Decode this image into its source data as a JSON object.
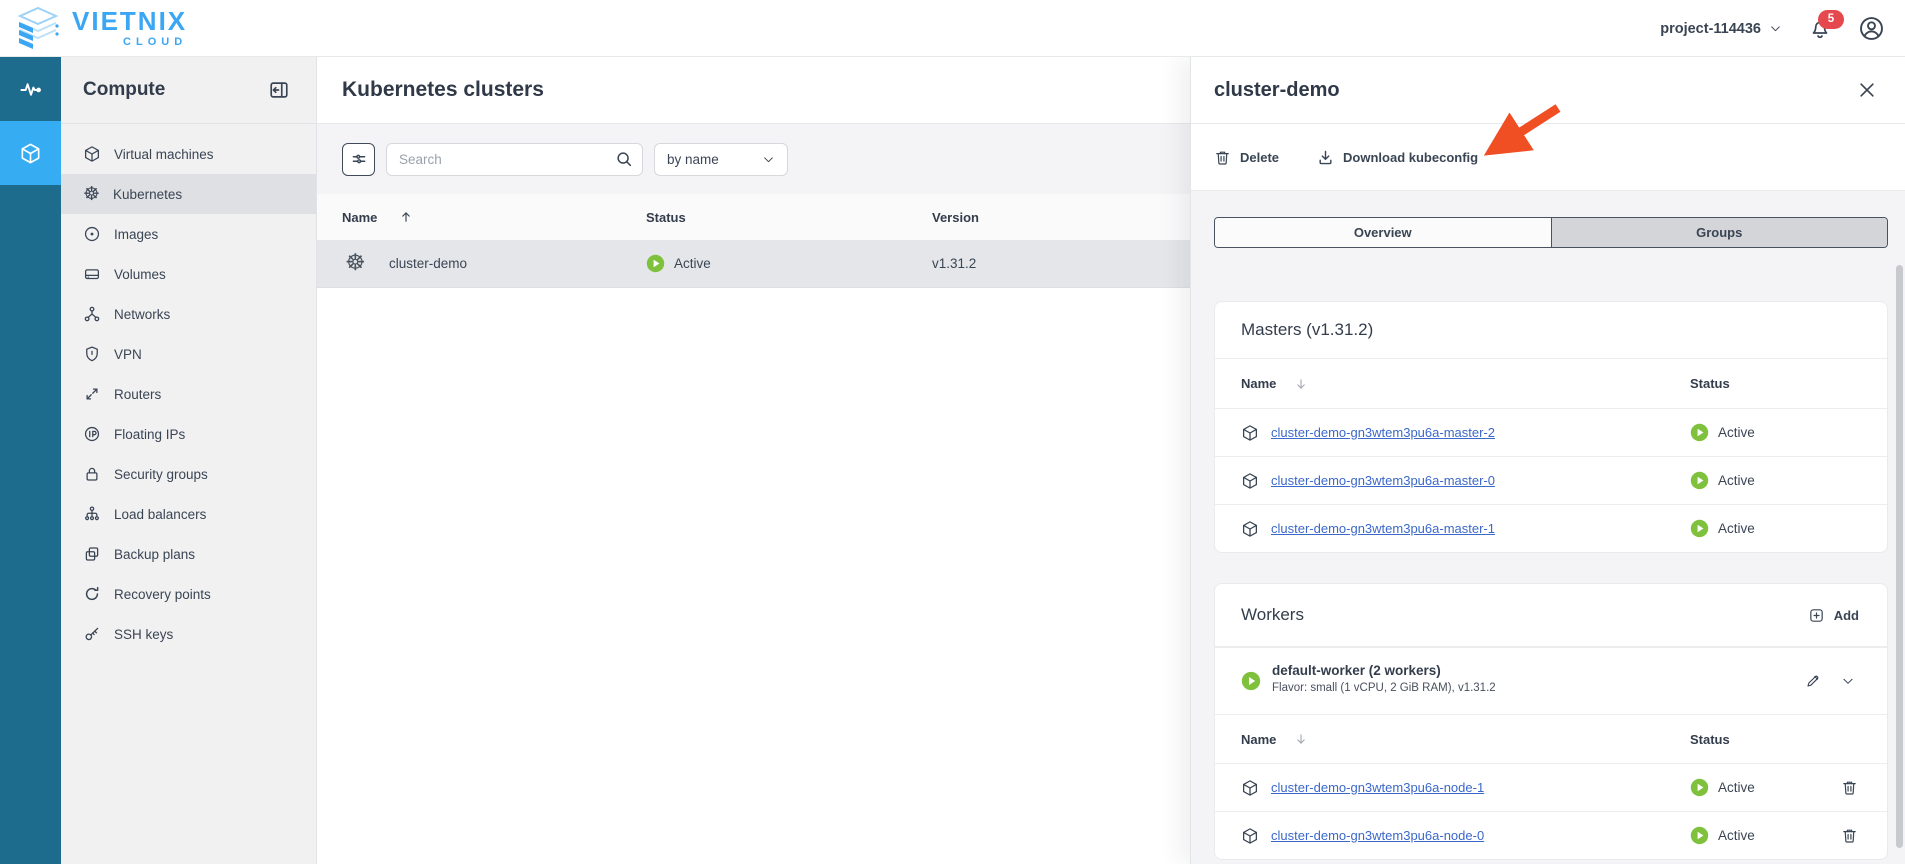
{
  "topbar": {
    "brand": "VIETNIX",
    "brand_sub": "CLOUD",
    "project_label": "project-114436",
    "notification_count": "5"
  },
  "rail": {
    "items": [
      {
        "icon": "activity",
        "selected": false
      },
      {
        "icon": "cube-solid",
        "selected": true
      }
    ]
  },
  "sidebar": {
    "heading": "Compute",
    "items": [
      {
        "icon": "cube",
        "label": "Virtual machines",
        "selected": false
      },
      {
        "icon": "kubernetes",
        "label": "Kubernetes",
        "selected": true
      },
      {
        "icon": "circle-dot",
        "label": "Images",
        "selected": false
      },
      {
        "icon": "drive",
        "label": "Volumes",
        "selected": false
      },
      {
        "icon": "network",
        "label": "Networks",
        "selected": false
      },
      {
        "icon": "shield",
        "label": "VPN",
        "selected": false
      },
      {
        "icon": "swap-arrows",
        "label": "Routers",
        "selected": false
      },
      {
        "icon": "floating-ip",
        "label": "Floating IPs",
        "selected": false
      },
      {
        "icon": "lock",
        "label": "Security groups",
        "selected": false
      },
      {
        "icon": "load-balancer",
        "label": "Load balancers",
        "selected": false
      },
      {
        "icon": "copy",
        "label": "Backup plans",
        "selected": false
      },
      {
        "icon": "refresh",
        "label": "Recovery points",
        "selected": false
      },
      {
        "icon": "key",
        "label": "SSH keys",
        "selected": false
      }
    ]
  },
  "main": {
    "title": "Kubernetes clusters",
    "search_placeholder": "Search",
    "sort_selected": "by name",
    "table": {
      "col_name": "Name",
      "col_status": "Status",
      "col_version": "Version",
      "rows": [
        {
          "name": "cluster-demo",
          "status": "Active",
          "version": "v1.31.2"
        }
      ]
    }
  },
  "panel": {
    "title": "cluster-demo",
    "actions": {
      "delete_label": "Delete",
      "download_label": "Download kubeconfig"
    },
    "tabs": [
      {
        "label": "Overview",
        "selected": false
      },
      {
        "label": "Groups",
        "selected": true
      }
    ],
    "masters": {
      "title": "Masters (v1.31.2)",
      "col_name": "Name",
      "col_status": "Status",
      "rows": [
        {
          "name": "cluster-demo-gn3wtem3pu6a-master-2",
          "status": "Active"
        },
        {
          "name": "cluster-demo-gn3wtem3pu6a-master-0",
          "status": "Active"
        },
        {
          "name": "cluster-demo-gn3wtem3pu6a-master-1",
          "status": "Active"
        }
      ]
    },
    "workers": {
      "title": "Workers",
      "add_label": "Add",
      "group": {
        "name": "default-worker (2 workers)",
        "flavor": "Flavor: small (1 vCPU, 2 GiB RAM), v1.31.2"
      },
      "col_name": "Name",
      "col_status": "Status",
      "rows": [
        {
          "name": "cluster-demo-gn3wtem3pu6a-node-1",
          "status": "Active"
        },
        {
          "name": "cluster-demo-gn3wtem3pu6a-node-0",
          "status": "Active"
        }
      ]
    }
  },
  "colors": {
    "rail_dark": "#1D6C8E",
    "accent_blue": "#36ADF2",
    "brand_blue": "#3BA6F3",
    "status_green": "#7FC13C",
    "link_blue": "#3B68C9",
    "badge_red": "#E5484D",
    "arrow_orange": "#F04E23"
  }
}
